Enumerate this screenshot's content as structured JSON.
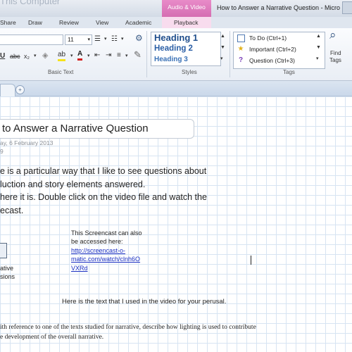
{
  "window": {
    "ghost_text": "This Computer",
    "title": "How to Answer a Narrative Question  -  Micro",
    "context_tab_group": "Audio & Video"
  },
  "ribbon_tabs": [
    "Share",
    "Draw",
    "Review",
    "View",
    "Academic",
    "Playback"
  ],
  "ribbon": {
    "font_size": "11",
    "basic_text_label": "Basic Text",
    "styles_label": "Styles",
    "tags_label": "Tags",
    "styles": [
      "Heading 1",
      "Heading 2",
      "Heading 3"
    ],
    "tags": [
      {
        "icon": "todo-checkbox-icon",
        "label": "To Do (Ctrl+1)"
      },
      {
        "icon": "star-icon",
        "label": "Important (Ctrl+2)"
      },
      {
        "icon": "question-icon",
        "label": "Question (Ctrl+3)"
      }
    ],
    "find_tags_label_1": "Find",
    "find_tags_label_2": "Tags"
  },
  "page": {
    "title": "to Answer a Narrative Question",
    "date": "ay, 6 February 2013",
    "time": "9",
    "body_lines": [
      "e is a particular way that I like to see questions about",
      "luction and story elements answered.",
      "here it is. Double click on the video file and watch the",
      "ecast."
    ],
    "file_label_1": "ative",
    "file_label_2": "sions",
    "aside_lines": [
      "This Screencast can also",
      "be accessed here:"
    ],
    "link_lines": [
      "http://screencast-o-",
      "matic.com/watch/clnh6O",
      "VXRd"
    ],
    "perusal": "Here is the text that I used in the video for your perusal.",
    "question_lines": [
      "ith reference to one of the texts studied for narrative, describe how lighting  is used to contribute",
      "e development of the overall narrative."
    ]
  },
  "colors": {
    "context_tab": "#d56db2",
    "heading_blue": "#1f4e8c",
    "link": "#1a2fc2",
    "grid": "#d7e4f2"
  }
}
